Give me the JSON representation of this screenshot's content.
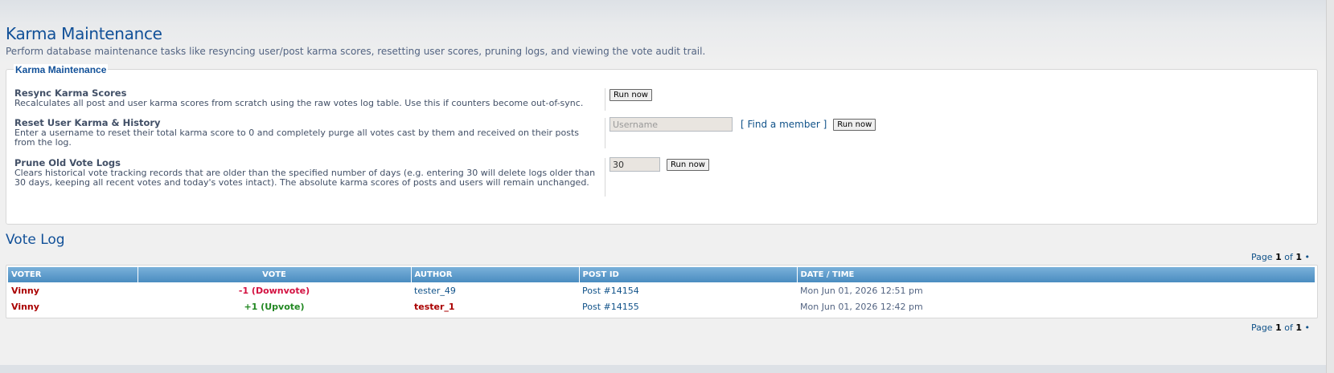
{
  "page": {
    "title": "Karma Maintenance",
    "description": "Perform database maintenance tasks like resyncing user/post karma scores, resetting user scores, pruning logs, and viewing the vote audit trail."
  },
  "maintenance": {
    "legend": "Karma Maintenance",
    "resync": {
      "label": "Resync Karma Scores",
      "explain": "Recalculates all post and user karma scores from scratch using the raw votes log table. Use this if counters become out-of-sync.",
      "button": "Run now"
    },
    "reset": {
      "label": "Reset User Karma & History",
      "explain": "Enter a username to reset their total karma score to 0 and completely purge all votes cast by them and received on their posts from the log.",
      "username_placeholder": "Username",
      "username_value": "",
      "find_member_open": "[ ",
      "find_member": "Find a member",
      "find_member_close": " ]",
      "button": "Run now"
    },
    "prune": {
      "label": "Prune Old Vote Logs",
      "explain": "Clears historical vote tracking records that are older than the specified number of days (e.g. entering 30 will delete logs older than 30 days, keeping all recent votes and today's votes intact). The absolute karma scores of posts and users will remain unchanged.",
      "days_value": "30",
      "button": "Run now"
    }
  },
  "vote_log": {
    "title": "Vote Log",
    "pagination": {
      "prefix": "Page ",
      "current": "1",
      "of": " of ",
      "total": "1",
      "bullet": " •"
    },
    "columns": [
      "Voter",
      "Vote",
      "Author",
      "Post ID",
      "Date / Time"
    ],
    "rows": [
      {
        "voter": "Vinny",
        "vote": "-1 (Downvote)",
        "vote_type": "down",
        "author": "tester_49",
        "author_highlight": false,
        "post": "Post #14154",
        "datetime": "Mon Jun 01, 2026 12:51 pm"
      },
      {
        "voter": "Vinny",
        "vote": "+1 (Upvote)",
        "vote_type": "up",
        "author": "tester_1",
        "author_highlight": true,
        "post": "Post #14155",
        "datetime": "Mon Jun 01, 2026 12:42 pm"
      }
    ]
  },
  "colors": {
    "heading": "#115098",
    "link": "#105289",
    "downvote": "#d31141",
    "upvote": "#228822",
    "username": "#aa0000",
    "table_header": "#5b9bc9"
  }
}
